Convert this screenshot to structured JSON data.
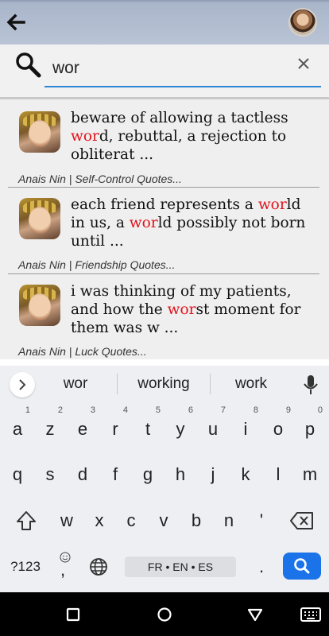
{
  "header": {
    "back_icon": "arrow-left-icon",
    "avatar": "profile-avatar"
  },
  "search": {
    "value": "wor",
    "placeholder": "",
    "search_icon": "magnifier-icon",
    "clear_icon": "close-icon"
  },
  "results": [
    {
      "quote_before": "beware of allowing a tactless ",
      "quote_highlight": "wor",
      "quote_after": "d, rebuttal, a rejection to obliterat ...",
      "source": "Anais Nin | Self-Control Quotes..."
    },
    {
      "quote_before": "each friend represents a ",
      "quote_highlight": "wor",
      "quote_middle": "ld in us, a ",
      "quote_highlight2": "wor",
      "quote_after": "ld possibly not born until ...",
      "source": "Anais Nin | Friendship Quotes..."
    },
    {
      "quote_before": "i was thinking of my patients, and how the ",
      "quote_highlight": "wor",
      "quote_after": "st moment for them was w ...",
      "source": "Anais Nin | Luck Quotes..."
    }
  ],
  "colors": {
    "highlight": "#e0131c",
    "accent": "#1a73e8",
    "appbar": "#b9c4d6"
  },
  "keyboard": {
    "suggestions": [
      "wor",
      "working",
      "work"
    ],
    "row1": [
      {
        "k": "a",
        "h": "1"
      },
      {
        "k": "z",
        "h": "2"
      },
      {
        "k": "e",
        "h": "3"
      },
      {
        "k": "r",
        "h": "4"
      },
      {
        "k": "t",
        "h": "5"
      },
      {
        "k": "y",
        "h": "6"
      },
      {
        "k": "u",
        "h": "7"
      },
      {
        "k": "i",
        "h": "8"
      },
      {
        "k": "o",
        "h": "9"
      },
      {
        "k": "p",
        "h": "0"
      }
    ],
    "row2": [
      "q",
      "s",
      "d",
      "f",
      "g",
      "h",
      "j",
      "k",
      "l",
      "m"
    ],
    "row3": [
      "w",
      "x",
      "c",
      "v",
      "b",
      "n",
      "'"
    ],
    "symbols_label": "?123",
    "comma": ",",
    "period": ".",
    "space_label": "FR • EN • ES"
  },
  "nav": {
    "recents_icon": "square-icon",
    "home_icon": "circle-home-icon",
    "back_icon": "triangle-back-icon",
    "keyboard_icon": "keyboard-icon"
  }
}
